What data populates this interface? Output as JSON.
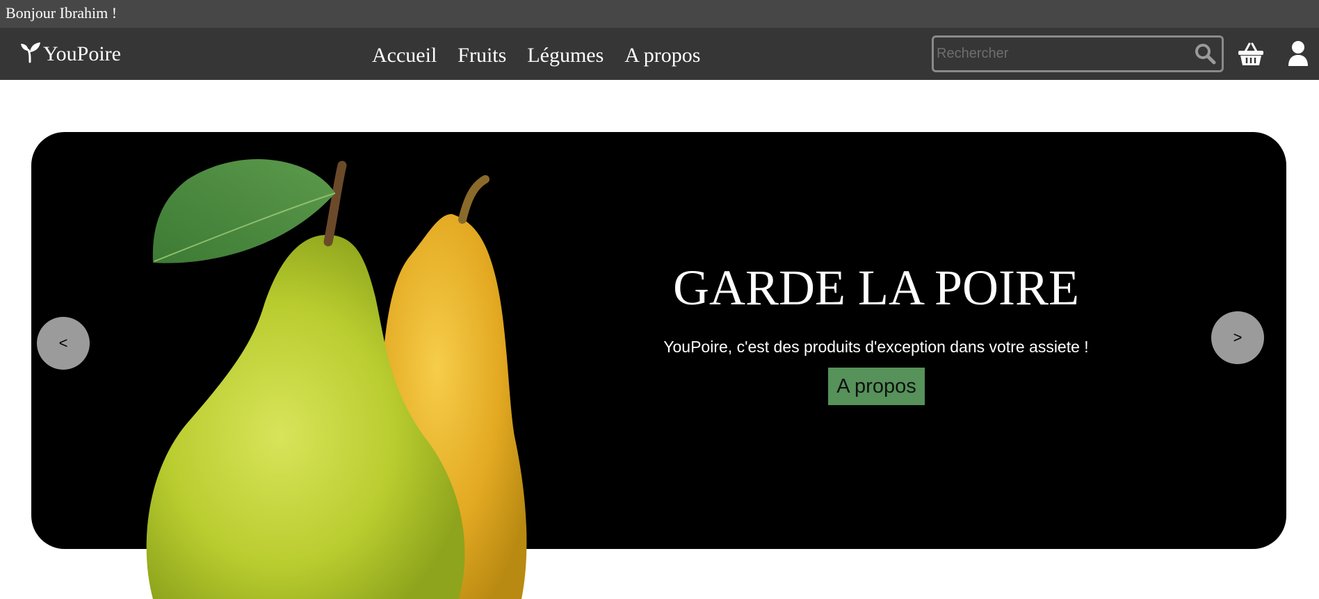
{
  "greeting": "Bonjour Ibrahim !",
  "brand": {
    "name": "YouPoire",
    "icon": "sprout-icon"
  },
  "nav": {
    "links": [
      {
        "label": "Accueil"
      },
      {
        "label": "Fruits"
      },
      {
        "label": "Légumes"
      },
      {
        "label": "A propos"
      }
    ]
  },
  "search": {
    "placeholder": "Rechercher",
    "value": "",
    "icon": "search-icon"
  },
  "header_icons": {
    "cart": "basket-icon",
    "account": "user-icon"
  },
  "hero": {
    "title": "GARDE LA POIRE",
    "subtitle": "YouPoire, c'est des produits d'exception dans votre assiete !",
    "cta_label": "A propos",
    "prev_label": "<",
    "next_label": ">"
  },
  "colors": {
    "greeting_bar": "#474747",
    "navbar": "#363636",
    "hero_background": "#000000",
    "cta": "#56925a",
    "carousel_button": "#9b9b9b"
  }
}
